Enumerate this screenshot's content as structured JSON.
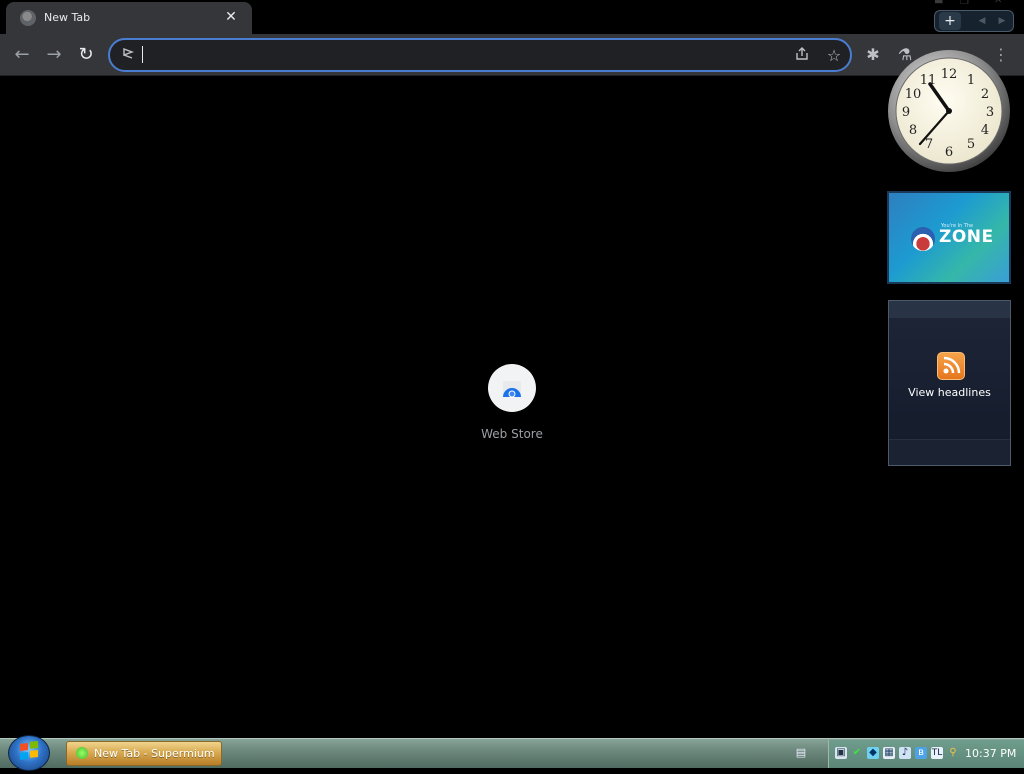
{
  "browser": {
    "tab": {
      "title": "New Tab",
      "close_glyph": "✕"
    },
    "new_tab_glyph": "+",
    "toolbar": {
      "back_glyph": "←",
      "forward_glyph": "→",
      "reload_glyph": "↻",
      "extensions_glyph": "✱",
      "labs_glyph": "⚗",
      "menu_glyph": "⋮"
    },
    "omnibox": {
      "value": "",
      "placeholder": "",
      "icon": "site-info-icon",
      "share_glyph": "⇪",
      "star_glyph": "☆"
    }
  },
  "new_tab_page": {
    "shortcuts": [
      {
        "label": "Web Store"
      }
    ]
  },
  "gadgets": {
    "clock": {
      "numerals": [
        "12",
        "1",
        "2",
        "3",
        "4",
        "5",
        "6",
        "7",
        "8",
        "9",
        "10",
        "11"
      ]
    },
    "zone": {
      "small_text": "You're In The",
      "title": "ZONE"
    },
    "news": {
      "label": "View headlines"
    }
  },
  "taskbar": {
    "task_label": "New Tab - Supermium",
    "time": "10:37 PM"
  },
  "colors": {
    "page_bg": "#000000",
    "tab_bg": "#35363a",
    "omnibox_border": "#4a7dcf",
    "taskbar": "#6f8a7e",
    "task_active": "#d8aa52"
  }
}
